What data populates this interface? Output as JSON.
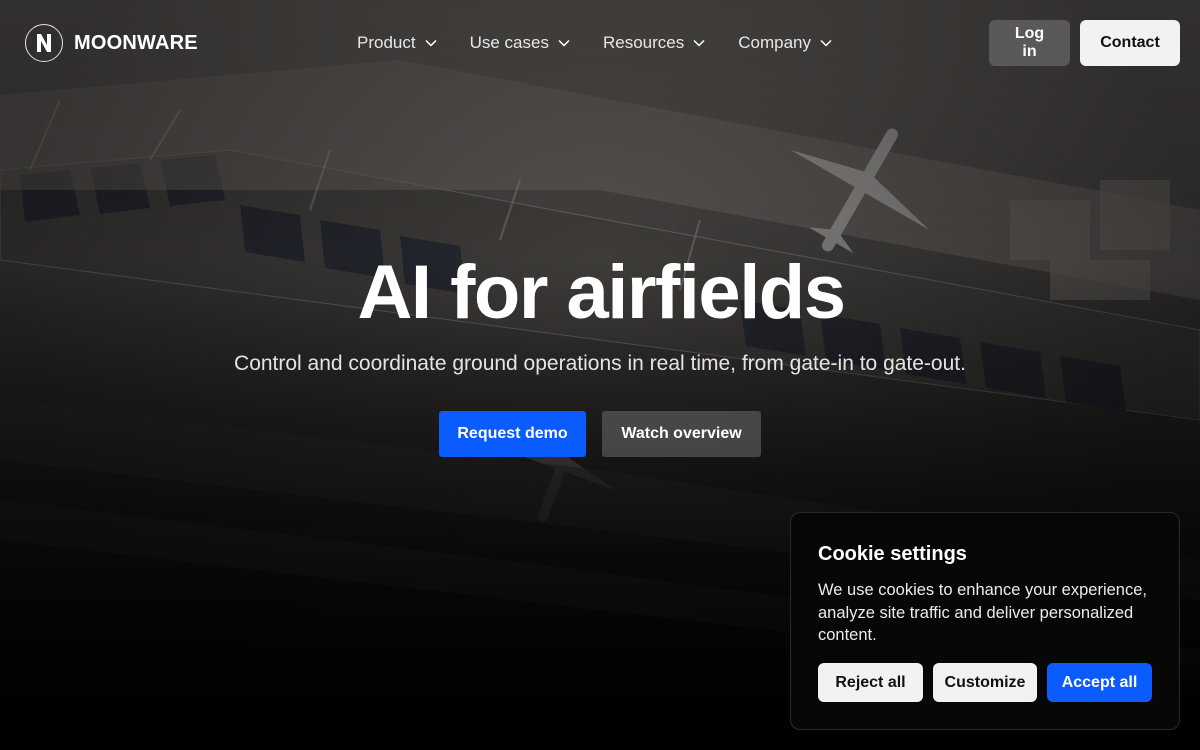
{
  "brand": {
    "name": "MOONWARE",
    "logo_letter": "N"
  },
  "nav": {
    "items": [
      {
        "label": "Product"
      },
      {
        "label": "Use cases"
      },
      {
        "label": "Resources"
      },
      {
        "label": "Company"
      }
    ]
  },
  "header": {
    "login_label": "Log in",
    "contact_label": "Contact"
  },
  "hero": {
    "title": "AI for airfields",
    "subtitle": "Control and coordinate ground operations in real time, from gate-in to gate-out.",
    "primary_cta": "Request demo",
    "secondary_cta": "Watch overview"
  },
  "cookie": {
    "title": "Cookie settings",
    "text": "We use cookies to enhance your experience, analyze site traffic and deliver personalized content.",
    "reject_label": "Reject all",
    "customize_label": "Customize",
    "accept_label": "Accept all"
  },
  "colors": {
    "accent": "#0a5cff",
    "light_button": "#f2f2f2",
    "panel_bg": "#070707"
  },
  "icons": {
    "nav_dropdown": "chevron-down-icon",
    "logo": "moonware-logo-icon"
  }
}
